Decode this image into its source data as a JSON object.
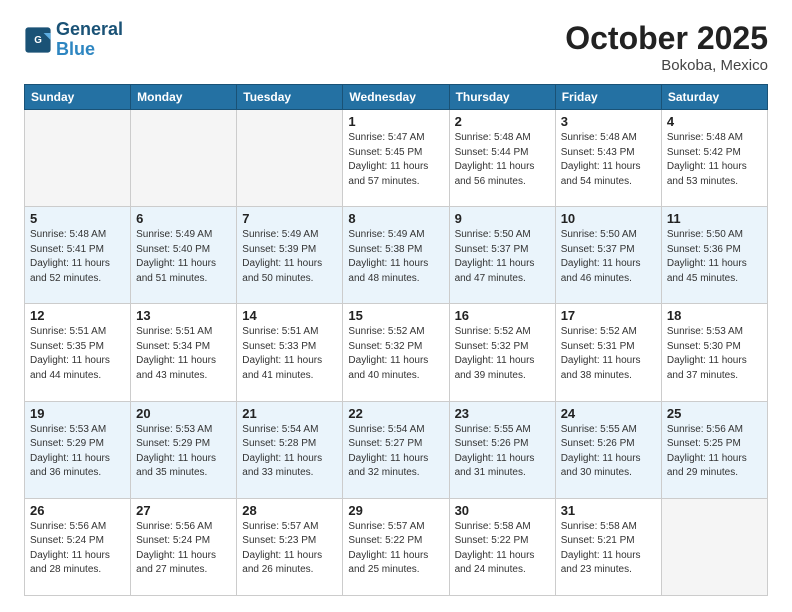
{
  "logo": {
    "line1": "General",
    "line2": "Blue"
  },
  "title": "October 2025",
  "location": "Bokoba, Mexico",
  "days_header": [
    "Sunday",
    "Monday",
    "Tuesday",
    "Wednesday",
    "Thursday",
    "Friday",
    "Saturday"
  ],
  "weeks": [
    [
      {
        "day": "",
        "info": ""
      },
      {
        "day": "",
        "info": ""
      },
      {
        "day": "",
        "info": ""
      },
      {
        "day": "1",
        "info": "Sunrise: 5:47 AM\nSunset: 5:45 PM\nDaylight: 11 hours\nand 57 minutes."
      },
      {
        "day": "2",
        "info": "Sunrise: 5:48 AM\nSunset: 5:44 PM\nDaylight: 11 hours\nand 56 minutes."
      },
      {
        "day": "3",
        "info": "Sunrise: 5:48 AM\nSunset: 5:43 PM\nDaylight: 11 hours\nand 54 minutes."
      },
      {
        "day": "4",
        "info": "Sunrise: 5:48 AM\nSunset: 5:42 PM\nDaylight: 11 hours\nand 53 minutes."
      }
    ],
    [
      {
        "day": "5",
        "info": "Sunrise: 5:48 AM\nSunset: 5:41 PM\nDaylight: 11 hours\nand 52 minutes."
      },
      {
        "day": "6",
        "info": "Sunrise: 5:49 AM\nSunset: 5:40 PM\nDaylight: 11 hours\nand 51 minutes."
      },
      {
        "day": "7",
        "info": "Sunrise: 5:49 AM\nSunset: 5:39 PM\nDaylight: 11 hours\nand 50 minutes."
      },
      {
        "day": "8",
        "info": "Sunrise: 5:49 AM\nSunset: 5:38 PM\nDaylight: 11 hours\nand 48 minutes."
      },
      {
        "day": "9",
        "info": "Sunrise: 5:50 AM\nSunset: 5:37 PM\nDaylight: 11 hours\nand 47 minutes."
      },
      {
        "day": "10",
        "info": "Sunrise: 5:50 AM\nSunset: 5:37 PM\nDaylight: 11 hours\nand 46 minutes."
      },
      {
        "day": "11",
        "info": "Sunrise: 5:50 AM\nSunset: 5:36 PM\nDaylight: 11 hours\nand 45 minutes."
      }
    ],
    [
      {
        "day": "12",
        "info": "Sunrise: 5:51 AM\nSunset: 5:35 PM\nDaylight: 11 hours\nand 44 minutes."
      },
      {
        "day": "13",
        "info": "Sunrise: 5:51 AM\nSunset: 5:34 PM\nDaylight: 11 hours\nand 43 minutes."
      },
      {
        "day": "14",
        "info": "Sunrise: 5:51 AM\nSunset: 5:33 PM\nDaylight: 11 hours\nand 41 minutes."
      },
      {
        "day": "15",
        "info": "Sunrise: 5:52 AM\nSunset: 5:32 PM\nDaylight: 11 hours\nand 40 minutes."
      },
      {
        "day": "16",
        "info": "Sunrise: 5:52 AM\nSunset: 5:32 PM\nDaylight: 11 hours\nand 39 minutes."
      },
      {
        "day": "17",
        "info": "Sunrise: 5:52 AM\nSunset: 5:31 PM\nDaylight: 11 hours\nand 38 minutes."
      },
      {
        "day": "18",
        "info": "Sunrise: 5:53 AM\nSunset: 5:30 PM\nDaylight: 11 hours\nand 37 minutes."
      }
    ],
    [
      {
        "day": "19",
        "info": "Sunrise: 5:53 AM\nSunset: 5:29 PM\nDaylight: 11 hours\nand 36 minutes."
      },
      {
        "day": "20",
        "info": "Sunrise: 5:53 AM\nSunset: 5:29 PM\nDaylight: 11 hours\nand 35 minutes."
      },
      {
        "day": "21",
        "info": "Sunrise: 5:54 AM\nSunset: 5:28 PM\nDaylight: 11 hours\nand 33 minutes."
      },
      {
        "day": "22",
        "info": "Sunrise: 5:54 AM\nSunset: 5:27 PM\nDaylight: 11 hours\nand 32 minutes."
      },
      {
        "day": "23",
        "info": "Sunrise: 5:55 AM\nSunset: 5:26 PM\nDaylight: 11 hours\nand 31 minutes."
      },
      {
        "day": "24",
        "info": "Sunrise: 5:55 AM\nSunset: 5:26 PM\nDaylight: 11 hours\nand 30 minutes."
      },
      {
        "day": "25",
        "info": "Sunrise: 5:56 AM\nSunset: 5:25 PM\nDaylight: 11 hours\nand 29 minutes."
      }
    ],
    [
      {
        "day": "26",
        "info": "Sunrise: 5:56 AM\nSunset: 5:24 PM\nDaylight: 11 hours\nand 28 minutes."
      },
      {
        "day": "27",
        "info": "Sunrise: 5:56 AM\nSunset: 5:24 PM\nDaylight: 11 hours\nand 27 minutes."
      },
      {
        "day": "28",
        "info": "Sunrise: 5:57 AM\nSunset: 5:23 PM\nDaylight: 11 hours\nand 26 minutes."
      },
      {
        "day": "29",
        "info": "Sunrise: 5:57 AM\nSunset: 5:22 PM\nDaylight: 11 hours\nand 25 minutes."
      },
      {
        "day": "30",
        "info": "Sunrise: 5:58 AM\nSunset: 5:22 PM\nDaylight: 11 hours\nand 24 minutes."
      },
      {
        "day": "31",
        "info": "Sunrise: 5:58 AM\nSunset: 5:21 PM\nDaylight: 11 hours\nand 23 minutes."
      },
      {
        "day": "",
        "info": ""
      }
    ]
  ]
}
